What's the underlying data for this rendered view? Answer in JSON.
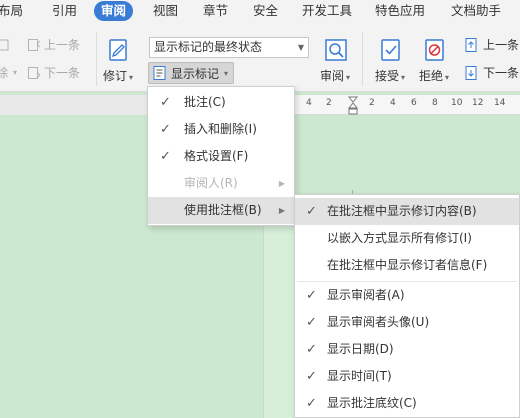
{
  "tabs": [
    "布局",
    "引用",
    "审阅",
    "视图",
    "章节",
    "安全",
    "开发工具",
    "特色应用",
    "文档助手"
  ],
  "ribbon": {
    "prev_change_1": "上一条",
    "next_change_1": "下一条",
    "revise": "修订",
    "display_mode": "显示标记的最终状态",
    "show_markup": "显示标记",
    "review": "审阅",
    "accept": "接受",
    "reject": "拒绝",
    "prev_change_2": "上一条",
    "next_change_2": "下一条"
  },
  "ruler_numbers": [
    "4",
    "2",
    "2",
    "4",
    "6",
    "8",
    "10",
    "12",
    "14"
  ],
  "menu": {
    "comments": "批注(C)",
    "insert_delete": "插入和删除(I)",
    "formatting": "格式设置(F)",
    "reviewers": "审阅人(R)",
    "balloons": "使用批注框(B)"
  },
  "submenu": {
    "show_revisions_in_balloons": "在批注框中显示修订内容(B)",
    "show_all_inline": "以嵌入方式显示所有修订(I)",
    "show_reviewer_info": "在批注框中显示修订者信息(F)",
    "show_reviewer": "显示审阅者(A)",
    "show_reviewer_avatar": "显示审阅者头像(U)",
    "show_date": "显示日期(D)",
    "show_time": "显示时间(T)",
    "show_comment_shading": "显示批注底纹(C)"
  },
  "colors": {
    "accent": "#3a7bd5",
    "document_bg": "#cce8cf",
    "reject_red": "#d9383a"
  }
}
